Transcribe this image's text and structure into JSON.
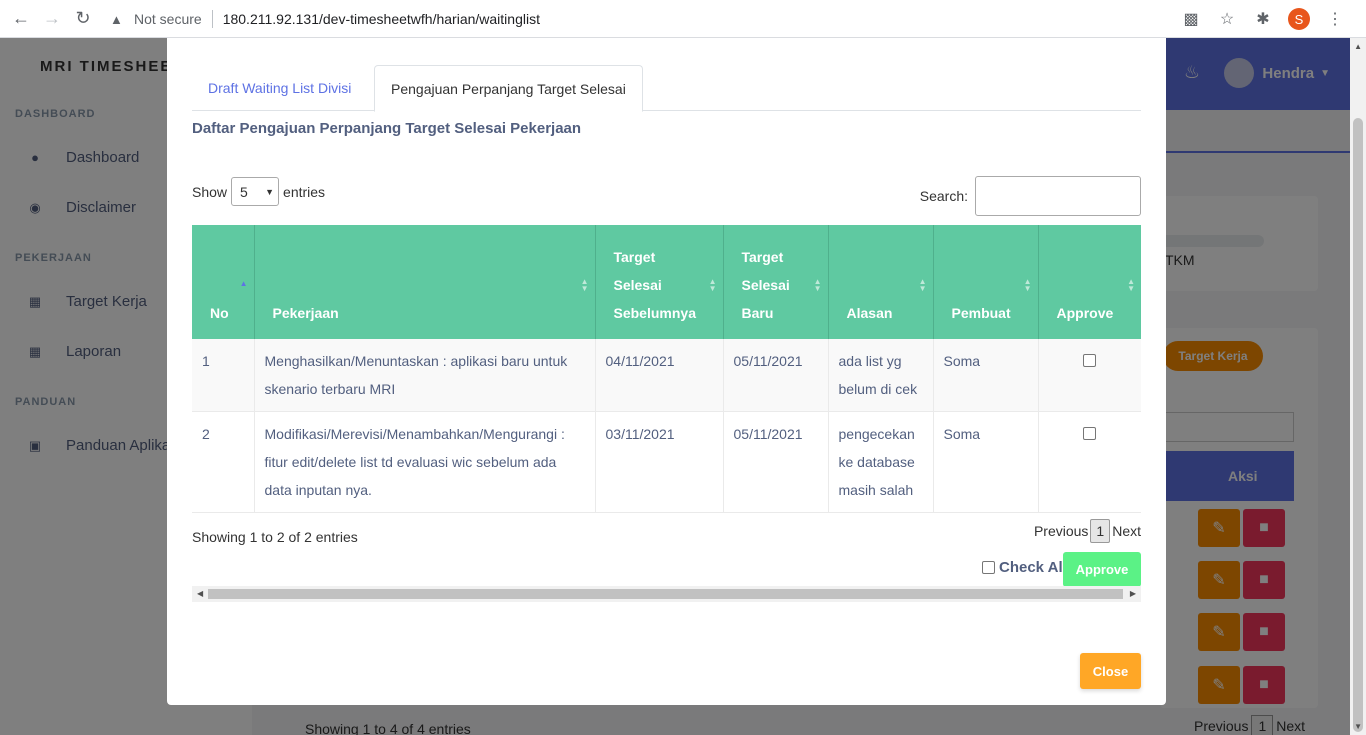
{
  "browser": {
    "not_secure": "Not secure",
    "url": "180.211.92.131/dev-timesheetwfh/harian/waitinglist",
    "profile_initial": "S"
  },
  "app": {
    "brand": "MRI TIMESHEET",
    "sidebar": {
      "headings": [
        "DASHBOARD",
        "PEKERJAAN",
        "PANDUAN"
      ],
      "items": [
        {
          "label": "Dashboard",
          "icon": "droplet-icon"
        },
        {
          "label": "Disclaimer",
          "icon": "info-icon"
        },
        {
          "label": "Target Kerja",
          "icon": "table-icon"
        },
        {
          "label": "Laporan",
          "icon": "table-icon"
        },
        {
          "label": "Panduan Aplika",
          "icon": "book-icon"
        }
      ]
    },
    "user_name": "Hendra",
    "tkm": "TKM",
    "target_kerja_btn": "Target Kerja",
    "aksi": "Aksi",
    "showing": "Showing 1 to 4 of 4 entries",
    "pager": {
      "previous": "Previous",
      "page": "1",
      "next": "Next"
    }
  },
  "modal": {
    "tabs": [
      {
        "label": "Draft Waiting List Divisi",
        "active": false
      },
      {
        "label": "Pengajuan Perpanjang Target Selesai",
        "active": true
      }
    ],
    "section_title": "Daftar Pengajuan Perpanjang Target Selesai Pekerjaan",
    "show_label": "Show",
    "show_value": "5",
    "entries_label": "entries",
    "search_label": "Search:",
    "columns": {
      "no": "No",
      "pekerjaan": "Pekerjaan",
      "target_prev_1": "Target Selesai",
      "target_prev_2": "Sebelumnya",
      "target_new_1": "Target",
      "target_new_2": "Selesai",
      "target_new_3": "Baru",
      "alasan": "Alasan",
      "pembuat": "Pembuat",
      "approve": "Approve"
    },
    "rows": [
      {
        "no": "1",
        "pekerjaan": "Menghasilkan/Menuntaskan : aplikasi baru untuk skenario terbaru MRI",
        "target_prev": "04/11/2021",
        "target_new": "05/11/2021",
        "alasan": "ada list yg belum di cek",
        "pembuat": "Soma"
      },
      {
        "no": "2",
        "pekerjaan": "Modifikasi/Merevisi/Menambahkan/Mengurangi : fitur edit/delete list td evaluasi wic sebelum ada data inputan nya.",
        "target_prev": "03/11/2021",
        "target_new": "05/11/2021",
        "alasan": "pengecekan ke database masih salah",
        "pembuat": "Soma"
      }
    ],
    "showing": "Showing 1 to 2 of 2 entries",
    "pager": {
      "previous": "Previous",
      "page": "1",
      "next": "Next"
    },
    "check_all": "Check All",
    "approve_btn": "Approve",
    "close_btn": "Close"
  }
}
